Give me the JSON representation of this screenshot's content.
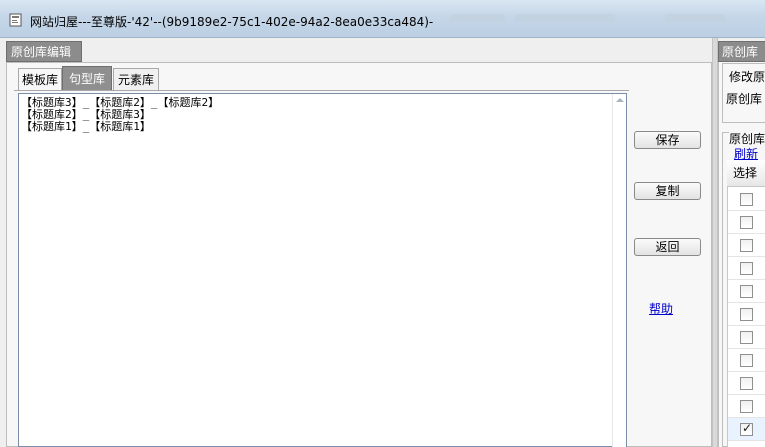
{
  "window": {
    "title": "网站归屋---至尊版-'42'--(9b9189e2-75c1-402e-94a2-8ea0e33ca484)-"
  },
  "left": {
    "panel_title": "原创库编辑",
    "tabs": [
      "模板库",
      "句型库",
      "元素库"
    ],
    "active_tab": "句型库",
    "editor_lines": [
      "【标题库3】_【标题库2】_【标题库2】",
      "【标题库2】_【标题库3】",
      "【标题库1】_【标题库1】"
    ],
    "buttons": {
      "save": "保存",
      "copy": "复制",
      "back": "返回"
    },
    "help": "帮助"
  },
  "right": {
    "panel_title": "原创库",
    "modify_group": "修改原",
    "source_label": "原创库",
    "list_group": "原创库",
    "refresh": "刷新",
    "grid_header": "选择",
    "rows_checked": [
      false,
      false,
      false,
      false,
      false,
      false,
      false,
      false,
      false,
      false,
      true
    ]
  },
  "icons": {
    "app": "app-window-icon",
    "checkbox": "checkbox-icon"
  },
  "colors": {
    "titlebar": "#c5d6e8",
    "tab_header": "#8c8c8c",
    "link": "#0000cc"
  }
}
